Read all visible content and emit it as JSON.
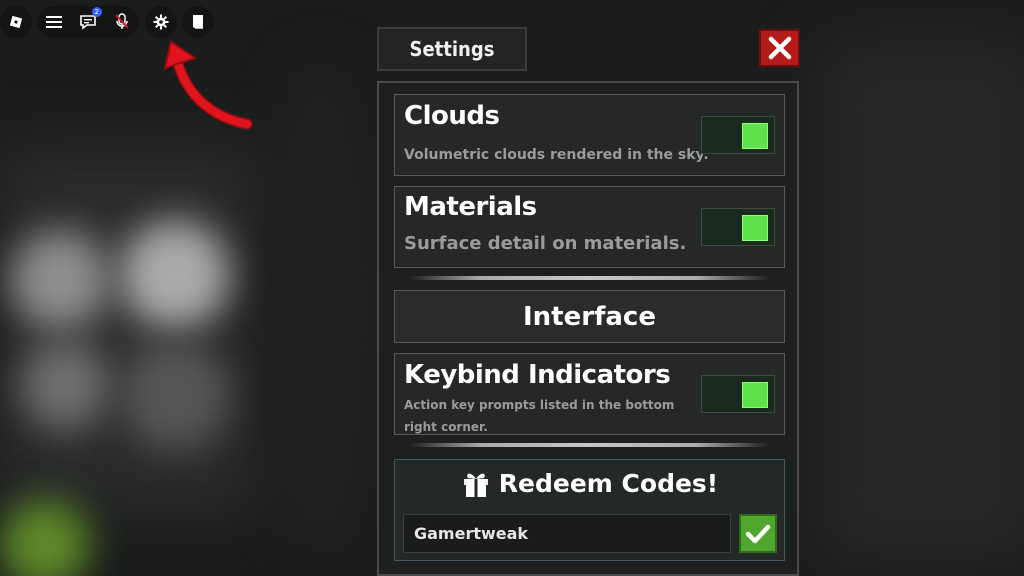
{
  "topbar": {
    "icons": [
      "roblox-logo-icon",
      "menu-icon",
      "chat-icon",
      "mic-muted-icon",
      "gear-icon",
      "book-icon"
    ],
    "chat_badge": "2"
  },
  "settings": {
    "title": "Settings",
    "close_icon": "close-icon",
    "rows": [
      {
        "title": "Clouds",
        "description": "Volumetric clouds rendered in the sky.",
        "enabled": true
      },
      {
        "title": "Materials",
        "description": "Surface detail on materials.",
        "enabled": true
      }
    ],
    "section_interface": "Interface",
    "interface_rows": [
      {
        "title": "Keybind Indicators",
        "description": "Action key prompts listed in the bottom right corner.",
        "enabled": true
      }
    ],
    "redeem": {
      "heading": "Redeem Codes!",
      "icon": "gift-icon",
      "input_value": "Gamertweak",
      "submit_icon": "checkmark-icon"
    }
  },
  "colors": {
    "toggle_on": "#5ee14a",
    "close_red": "#b51b1b",
    "submit_green": "#4fa82d",
    "arrow_red": "#e0141c"
  }
}
